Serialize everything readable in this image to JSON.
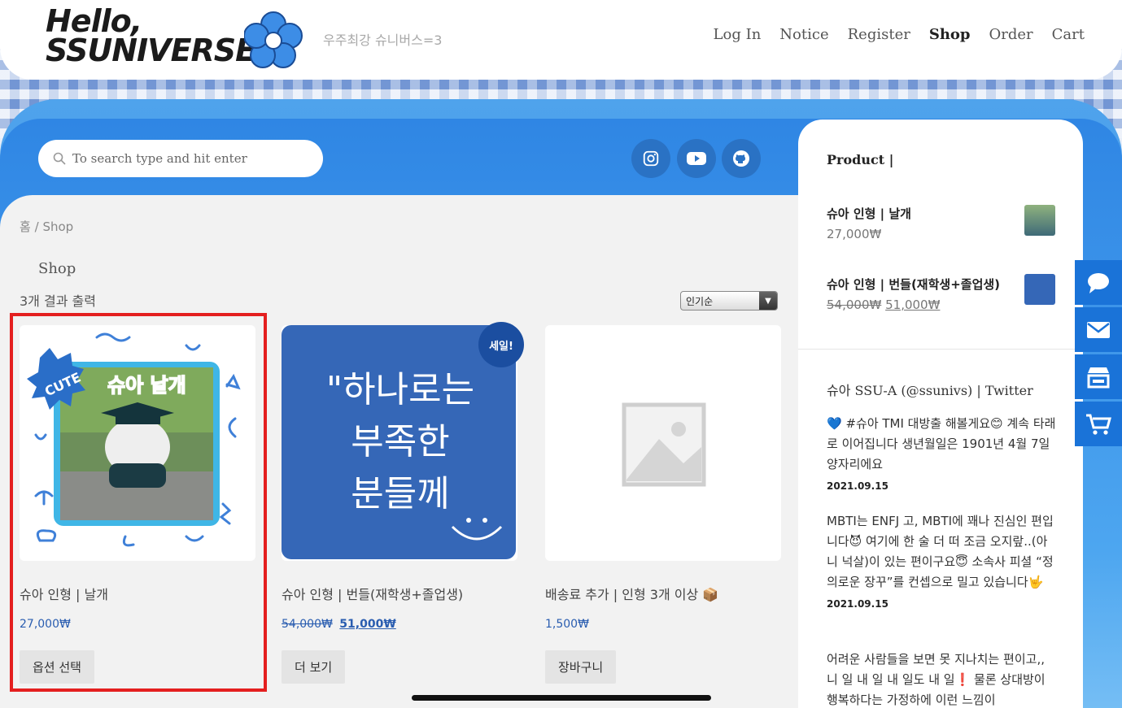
{
  "header": {
    "logo_line1": "Hello,",
    "logo_line2": "SSUNIVERSE",
    "tagline": "우주최강 슈니버스=3",
    "nav": [
      "Log In",
      "Notice",
      "Register",
      "Shop",
      "Order",
      "Cart"
    ],
    "nav_active": "Shop"
  },
  "search": {
    "placeholder": "To search type and hit enter"
  },
  "social_icons": [
    "instagram-icon",
    "youtube-icon",
    "github-icon"
  ],
  "breadcrumb": {
    "home": "홈",
    "separator": "/",
    "current": "Shop"
  },
  "page_title": "Shop",
  "result_count": "3개 결과 출력",
  "sort": {
    "selected": "인기순"
  },
  "products": [
    {
      "name": "슈아 인형 | 날개",
      "price": "27,000₩",
      "button": "옵션 선택",
      "image_text": [
        "CUTE",
        "슈아 날개"
      ]
    },
    {
      "name": "슈아 인형 | 번들(재학생+졸업생)",
      "price_old": "54,000₩",
      "price_new": "51,000₩",
      "button": "더 보기",
      "badge": "세일!",
      "image_text": [
        "\"하나로는",
        "부족한",
        "분들께"
      ]
    },
    {
      "name": "배송료 추가 | 인형 3개 이상 📦",
      "price": "1,500₩",
      "button": "장바구니"
    }
  ],
  "sidebar": {
    "title": "Product |",
    "items": [
      {
        "name": "슈아 인형 | 날개",
        "price": "27,000₩"
      },
      {
        "name": "슈아 인형 | 번들(재학생+졸업생)",
        "price_old": "54,000₩",
        "price_new": "51,000₩"
      }
    ],
    "twitter_heading": "슈아 SSU-A (@ssunivs) | Twitter",
    "tweets": [
      {
        "text": "💙 #슈아 TMI 대방출 해볼게요😊 계속 타래로 이어집니다 생년월일은 1901년 4월 7일 양자리에요",
        "date": "2021.09.15"
      },
      {
        "text": "MBTI는 ENFJ 고, MBTI에 꽤나 진심인 편입니다😈 여기에 한 술 더 떠 조금 오지랖..(아니 넉살)이 있는 편이구요😇 소속사 피셜 “정의로운 장꾸”를 컨셉으로 밀고 있습니다🤟",
        "date": "2021.09.15"
      },
      {
        "text": "어려운 사람들을 보면 못 지나치는 편이고,, 니 일 내 일 내 일도 내 일❗ 물론 상대방이 행복하다는 가정하에 이런 느낌이",
        "date": ""
      }
    ]
  },
  "floating_buttons": [
    "chat-icon",
    "mail-icon",
    "store-icon",
    "cart-icon"
  ],
  "colors": {
    "accent": "#1a73d8",
    "highlight": "#e41f1f",
    "price": "#2a5db0",
    "sale": "#1b4ea0"
  }
}
